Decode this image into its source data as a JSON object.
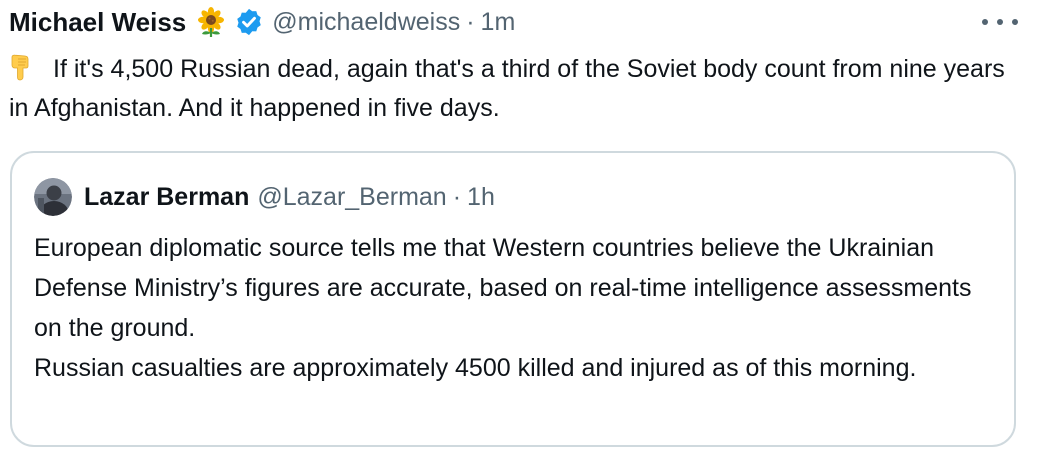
{
  "tweet": {
    "author_name": "Michael Weiss",
    "author_emoji": "sunflower",
    "verified_icon": "verified-badge-icon",
    "handle": "@michaeldweiss",
    "separator": "·",
    "time": "1m",
    "more_icon": "more-options-icon",
    "text_icon": "pointing-down-hand-icon",
    "text": "If it's 4,500 Russian dead, again that's a third of the Soviet body count from nine years in Afghanistan. And it happened in five days."
  },
  "quoted_tweet": {
    "author_name": "Lazar Berman",
    "handle": "@Lazar_Berman",
    "separator": "·",
    "time": "1h",
    "paragraphs": [
      "European diplomatic source tells me that Western countries believe the Ukrainian Defense Ministry’s figures are accurate, based on real-time intelligence assessments on the ground.",
      "Russian casualties are approximately 4500 killed and injured as of this morning."
    ]
  },
  "colors": {
    "text": "#0f1419",
    "secondary": "#536471",
    "verified": "#1d9bf0",
    "border": "#cfd9de"
  }
}
